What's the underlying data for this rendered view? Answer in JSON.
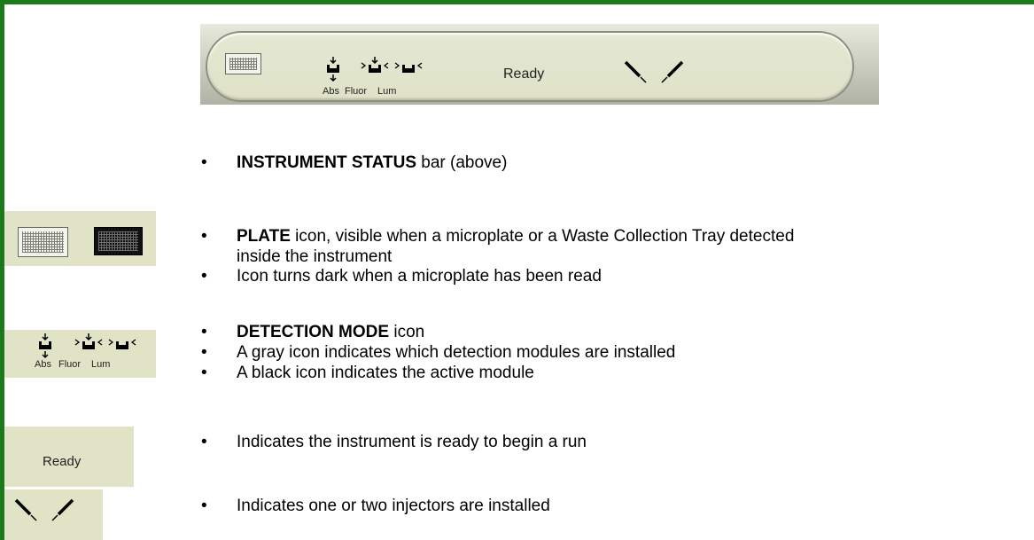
{
  "status_bar": {
    "mode_labels": [
      "Abs",
      "Fluor",
      "Lum"
    ],
    "status_text": "Ready"
  },
  "bullets": {
    "status_bar_bold": "INSTRUMENT STATUS",
    "status_bar_rest": " bar (above)",
    "plate_bold": "PLATE",
    "plate_rest": " icon, visible when a microplate or a Waste Collection Tray detected inside the instrument",
    "plate_dark": "Icon turns dark when a microplate has been read",
    "mode_bold": "DETECTION MODE",
    "mode_rest": " icon",
    "mode_gray": "A gray icon indicates which detection modules are installed",
    "mode_black": "A black icon indicates the active module",
    "ready_desc": "Indicates the instrument is ready to begin a run",
    "injector_desc": "Indicates one or two injectors are installed"
  },
  "legend": {
    "mode_labels": [
      "Abs",
      "Fluor",
      "Lum"
    ],
    "ready_text": "Ready"
  },
  "colors": {
    "frame": "#1a7a1a",
    "panel": "#e0e3c6"
  }
}
